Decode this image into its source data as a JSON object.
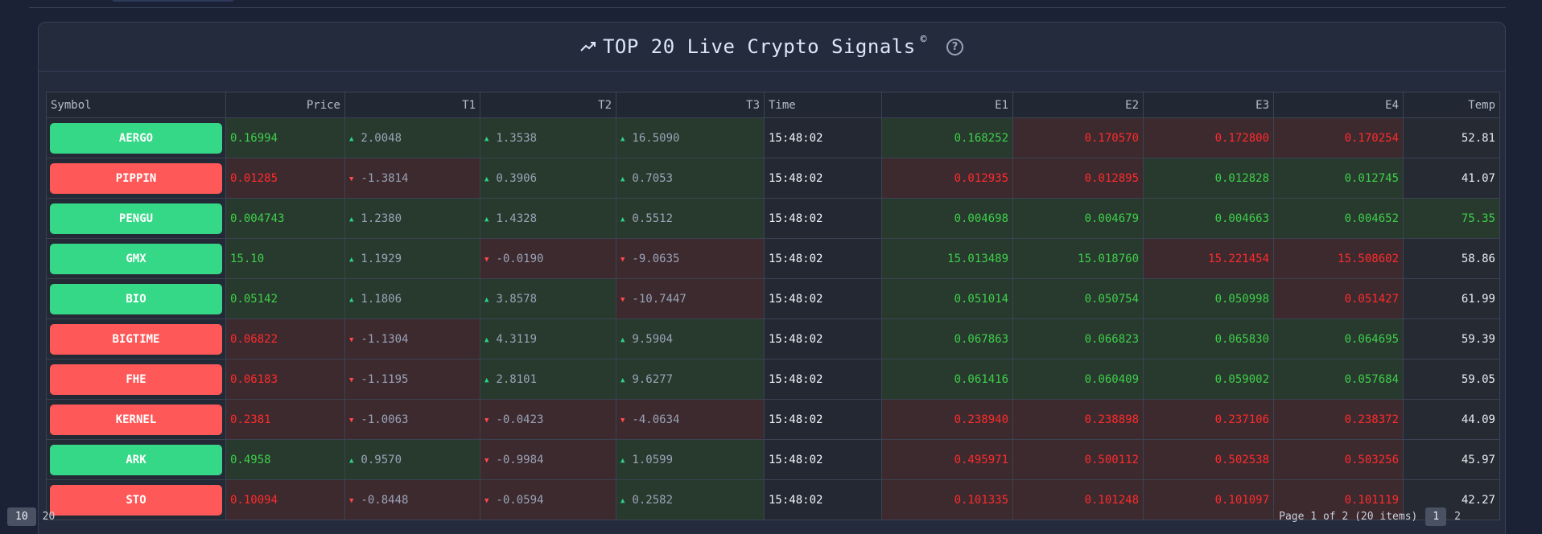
{
  "header": {
    "title": "TOP 20 Live Crypto Signals",
    "copyright_mark": "©",
    "help_glyph": "?"
  },
  "columns": [
    "Symbol",
    "Price",
    "T1",
    "T2",
    "T3",
    "Time",
    "E1",
    "E2",
    "E3",
    "E4",
    "Temp"
  ],
  "rows": [
    {
      "symbol": "AERGO",
      "dir": "up",
      "price": "0.16994",
      "price_c": "g",
      "t1": "2.0048",
      "t1d": "up",
      "t2": "1.3538",
      "t2d": "up",
      "t3": "16.5090",
      "t3d": "up",
      "time": "15:48:02",
      "e1": "0.168252",
      "e1c": "g",
      "e2": "0.170570",
      "e2c": "r",
      "e3": "0.172800",
      "e3c": "r",
      "e4": "0.170254",
      "e4c": "r",
      "temp": "52.81",
      "tempc": "w"
    },
    {
      "symbol": "PIPPIN",
      "dir": "down",
      "price": "0.01285",
      "price_c": "r",
      "t1": "-1.3814",
      "t1d": "down",
      "t2": "0.3906",
      "t2d": "up",
      "t3": "0.7053",
      "t3d": "up",
      "time": "15:48:02",
      "e1": "0.012935",
      "e1c": "r",
      "e2": "0.012895",
      "e2c": "r",
      "e3": "0.012828",
      "e3c": "g",
      "e4": "0.012745",
      "e4c": "g",
      "temp": "41.07",
      "tempc": "w"
    },
    {
      "symbol": "PENGU",
      "dir": "up",
      "price": "0.004743",
      "price_c": "g",
      "t1": "1.2380",
      "t1d": "up",
      "t2": "1.4328",
      "t2d": "up",
      "t3": "0.5512",
      "t3d": "up",
      "time": "15:48:02",
      "e1": "0.004698",
      "e1c": "g",
      "e2": "0.004679",
      "e2c": "g",
      "e3": "0.004663",
      "e3c": "g",
      "e4": "0.004652",
      "e4c": "g",
      "temp": "75.35",
      "tempc": "g"
    },
    {
      "symbol": "GMX",
      "dir": "up",
      "price": "15.10",
      "price_c": "g",
      "t1": "1.1929",
      "t1d": "up",
      "t2": "-0.0190",
      "t2d": "down",
      "t3": "-9.0635",
      "t3d": "down",
      "time": "15:48:02",
      "e1": "15.013489",
      "e1c": "g",
      "e2": "15.018760",
      "e2c": "g",
      "e3": "15.221454",
      "e3c": "r",
      "e4": "15.508602",
      "e4c": "r",
      "temp": "58.86",
      "tempc": "w"
    },
    {
      "symbol": "BIO",
      "dir": "up",
      "price": "0.05142",
      "price_c": "g",
      "t1": "1.1806",
      "t1d": "up",
      "t2": "3.8578",
      "t2d": "up",
      "t3": "-10.7447",
      "t3d": "down",
      "time": "15:48:02",
      "e1": "0.051014",
      "e1c": "g",
      "e2": "0.050754",
      "e2c": "g",
      "e3": "0.050998",
      "e3c": "g",
      "e4": "0.051427",
      "e4c": "r",
      "temp": "61.99",
      "tempc": "w"
    },
    {
      "symbol": "BIGTIME",
      "dir": "down",
      "price": "0.06822",
      "price_c": "r",
      "t1": "-1.1304",
      "t1d": "down",
      "t2": "4.3119",
      "t2d": "up",
      "t3": "9.5904",
      "t3d": "up",
      "time": "15:48:02",
      "e1": "0.067863",
      "e1c": "g",
      "e2": "0.066823",
      "e2c": "g",
      "e3": "0.065830",
      "e3c": "g",
      "e4": "0.064695",
      "e4c": "g",
      "temp": "59.39",
      "tempc": "w"
    },
    {
      "symbol": "FHE",
      "dir": "down",
      "price": "0.06183",
      "price_c": "r",
      "t1": "-1.1195",
      "t1d": "down",
      "t2": "2.8101",
      "t2d": "up",
      "t3": "9.6277",
      "t3d": "up",
      "time": "15:48:02",
      "e1": "0.061416",
      "e1c": "g",
      "e2": "0.060409",
      "e2c": "g",
      "e3": "0.059002",
      "e3c": "g",
      "e4": "0.057684",
      "e4c": "g",
      "temp": "59.05",
      "tempc": "w"
    },
    {
      "symbol": "KERNEL",
      "dir": "down",
      "price": "0.2381",
      "price_c": "r",
      "t1": "-1.0063",
      "t1d": "down",
      "t2": "-0.0423",
      "t2d": "down",
      "t3": "-4.0634",
      "t3d": "down",
      "time": "15:48:02",
      "e1": "0.238940",
      "e1c": "r",
      "e2": "0.238898",
      "e2c": "r",
      "e3": "0.237106",
      "e3c": "r",
      "e4": "0.238372",
      "e4c": "r",
      "temp": "44.09",
      "tempc": "w"
    },
    {
      "symbol": "ARK",
      "dir": "up",
      "price": "0.4958",
      "price_c": "g",
      "t1": "0.9570",
      "t1d": "up",
      "t2": "-0.9984",
      "t2d": "down",
      "t3": "1.0599",
      "t3d": "up",
      "time": "15:48:02",
      "e1": "0.495971",
      "e1c": "r",
      "e2": "0.500112",
      "e2c": "r",
      "e3": "0.502538",
      "e3c": "r",
      "e4": "0.503256",
      "e4c": "r",
      "temp": "45.97",
      "tempc": "w"
    },
    {
      "symbol": "STO",
      "dir": "down",
      "price": "0.10094",
      "price_c": "r",
      "t1": "-0.8448",
      "t1d": "down",
      "t2": "-0.0594",
      "t2d": "down",
      "t3": "0.2582",
      "t3d": "up",
      "time": "15:48:02",
      "e1": "0.101335",
      "e1c": "r",
      "e2": "0.101248",
      "e2c": "r",
      "e3": "0.101097",
      "e3c": "r",
      "e4": "0.101119",
      "e4c": "r",
      "temp": "42.27",
      "tempc": "w"
    }
  ],
  "footer": {
    "page_size_selected": "10",
    "page_size_other": "20",
    "page_info": "Page 1 of 2 (20 items)",
    "current_page": "1",
    "next_page": "2"
  },
  "colors": {
    "up": "#34d886",
    "down": "#ff5858",
    "text_green": "#3ecf4a",
    "text_red": "#ff2b2b"
  }
}
